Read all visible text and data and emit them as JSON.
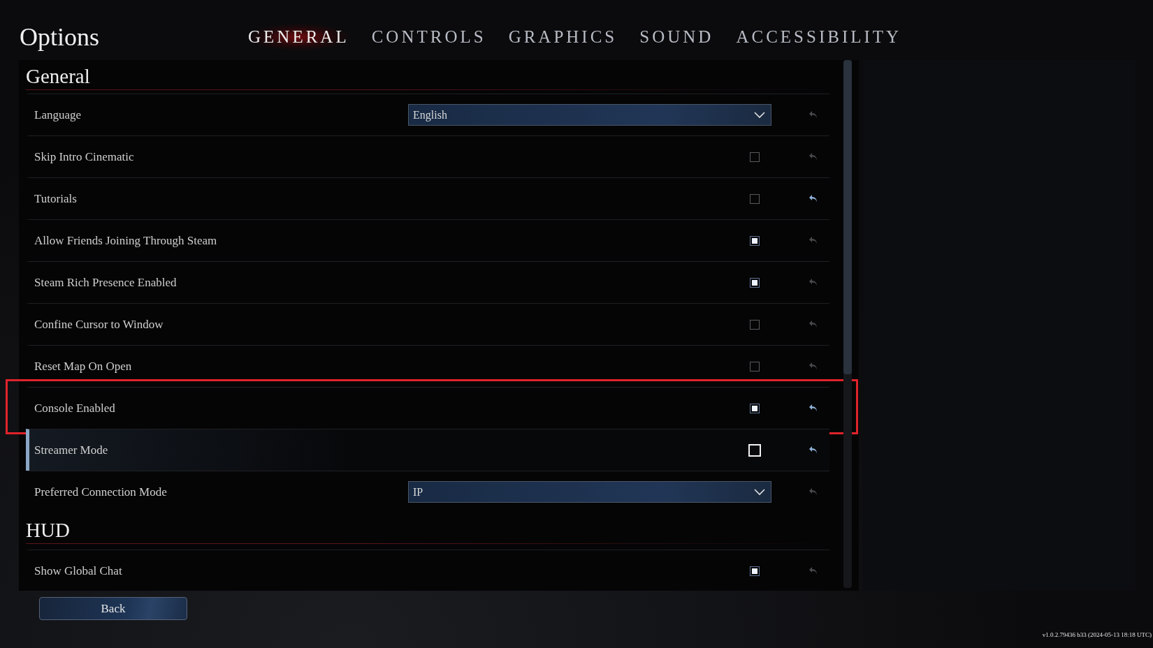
{
  "window": {
    "title": "Options"
  },
  "tabs": [
    {
      "label": "GENERAL",
      "selected": true
    },
    {
      "label": "CONTROLS",
      "selected": false
    },
    {
      "label": "GRAPHICS",
      "selected": false
    },
    {
      "label": "SOUND",
      "selected": false
    },
    {
      "label": "ACCESSIBILITY",
      "selected": false
    }
  ],
  "sections": [
    {
      "title": "General",
      "rows": [
        {
          "label": "Language",
          "kind": "dropdown",
          "value": "English",
          "reset_active": false,
          "focused": false,
          "highlighted": false
        },
        {
          "label": "Skip Intro Cinematic",
          "kind": "checkbox",
          "checked": false,
          "reset_active": false,
          "focused": false,
          "highlighted": false
        },
        {
          "label": "Tutorials",
          "kind": "checkbox",
          "checked": false,
          "reset_active": true,
          "focused": false,
          "highlighted": false
        },
        {
          "label": "Allow Friends Joining Through Steam",
          "kind": "checkbox",
          "checked": true,
          "reset_active": false,
          "focused": false,
          "highlighted": false
        },
        {
          "label": "Steam Rich Presence Enabled",
          "kind": "checkbox",
          "checked": true,
          "reset_active": false,
          "focused": false,
          "highlighted": false
        },
        {
          "label": "Confine Cursor to Window",
          "kind": "checkbox",
          "checked": false,
          "reset_active": false,
          "focused": false,
          "highlighted": false
        },
        {
          "label": "Reset Map On Open",
          "kind": "checkbox",
          "checked": false,
          "reset_active": false,
          "focused": false,
          "highlighted": false
        },
        {
          "label": "Console Enabled",
          "kind": "checkbox",
          "checked": true,
          "reset_active": true,
          "focused": false,
          "highlighted": true
        },
        {
          "label": "Streamer Mode",
          "kind": "checkbox",
          "checked": false,
          "reset_active": true,
          "focused": true,
          "highlighted": false
        },
        {
          "label": "Preferred Connection Mode",
          "kind": "dropdown",
          "value": "IP",
          "reset_active": false,
          "focused": false,
          "highlighted": false
        }
      ]
    },
    {
      "title": "HUD",
      "rows": [
        {
          "label": "Show Global Chat",
          "kind": "checkbox",
          "checked": true,
          "reset_active": false,
          "focused": false,
          "highlighted": false
        }
      ]
    }
  ],
  "back_button": "Back",
  "version": "v1.0.2.79436 b33 (2024-05-13 18:18 UTC)"
}
